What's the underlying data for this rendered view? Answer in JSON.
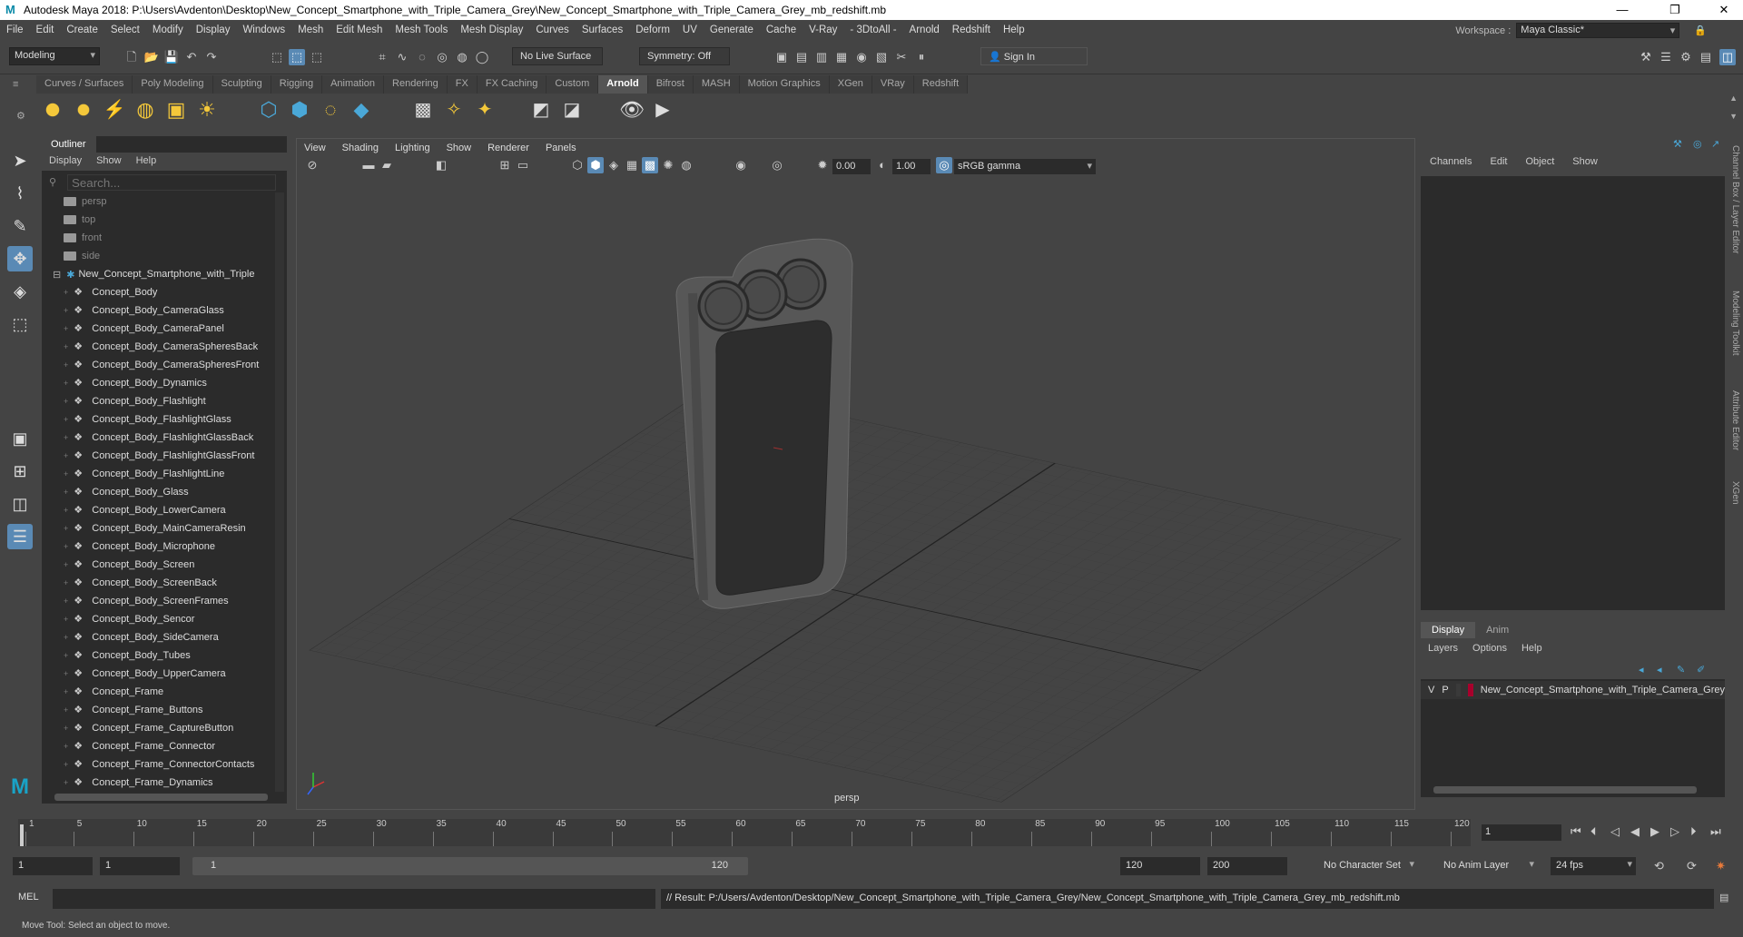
{
  "window": {
    "title": "Autodesk Maya 2018: P:\\Users\\Avdenton\\Desktop\\New_Concept_Smartphone_with_Triple_Camera_Grey\\New_Concept_Smartphone_with_Triple_Camera_Grey_mb_redshift.mb"
  },
  "menubar": [
    "File",
    "Edit",
    "Create",
    "Select",
    "Modify",
    "Display",
    "Windows",
    "Mesh",
    "Edit Mesh",
    "Mesh Tools",
    "Mesh Display",
    "Curves",
    "Surfaces",
    "Deform",
    "UV",
    "Generate",
    "Cache",
    "V-Ray",
    "- 3DtoAll -",
    "Arnold",
    "Redshift",
    "Help"
  ],
  "workspace": {
    "label": "Workspace :",
    "value": "Maya Classic*"
  },
  "statusline": {
    "mode": "Modeling",
    "live_surface": "No Live Surface",
    "symmetry": "Symmetry: Off",
    "sign_in": "Sign In"
  },
  "shelf_tabs": [
    "Curves / Surfaces",
    "Poly Modeling",
    "Sculpting",
    "Rigging",
    "Animation",
    "Rendering",
    "FX",
    "FX Caching",
    "Custom",
    "Arnold",
    "Bifrost",
    "MASH",
    "Motion Graphics",
    "XGen",
    "VRay",
    "Redshift"
  ],
  "shelf_active": "Arnold",
  "outliner": {
    "tab": "Outliner",
    "menu": [
      "Display",
      "Show",
      "Help"
    ],
    "search_placeholder": "Search...",
    "cameras": [
      "persp",
      "top",
      "front",
      "side"
    ],
    "group": "New_Concept_Smartphone_with_Triple",
    "items": [
      "Concept_Body",
      "Concept_Body_CameraGlass",
      "Concept_Body_CameraPanel",
      "Concept_Body_CameraSpheresBack",
      "Concept_Body_CameraSpheresFront",
      "Concept_Body_Dynamics",
      "Concept_Body_Flashlight",
      "Concept_Body_FlashlightGlass",
      "Concept_Body_FlashlightGlassBack",
      "Concept_Body_FlashlightGlassFront",
      "Concept_Body_FlashlightLine",
      "Concept_Body_Glass",
      "Concept_Body_LowerCamera",
      "Concept_Body_MainCameraResin",
      "Concept_Body_Microphone",
      "Concept_Body_Screen",
      "Concept_Body_ScreenBack",
      "Concept_Body_ScreenFrames",
      "Concept_Body_Sencor",
      "Concept_Body_SideCamera",
      "Concept_Body_Tubes",
      "Concept_Body_UpperCamera",
      "Concept_Frame",
      "Concept_Frame_Buttons",
      "Concept_Frame_CaptureButton",
      "Concept_Frame_Connector",
      "Concept_Frame_ConnectorContacts",
      "Concept_Frame_Dynamics"
    ]
  },
  "viewport": {
    "menu": [
      "View",
      "Shading",
      "Lighting",
      "Show",
      "Renderer",
      "Panels"
    ],
    "exposure": "0.00",
    "gamma": "1.00",
    "colorspace": "sRGB gamma",
    "camera_label": "persp"
  },
  "channelbox": {
    "menu": [
      "Channels",
      "Edit",
      "Object",
      "Show"
    ]
  },
  "layers": {
    "tabs": [
      "Display",
      "Anim"
    ],
    "menu": [
      "Layers",
      "Options",
      "Help"
    ],
    "row": {
      "v": "V",
      "p": "P",
      "name": "New_Concept_Smartphone_with_Triple_Camera_Grey",
      "color": "#a8002c"
    }
  },
  "side_tabs": [
    "Channel Box / Layer Editor",
    "Modeling Toolkit",
    "Attribute Editor",
    "XGen"
  ],
  "timeline": {
    "ticks": [
      "1",
      "5",
      "10",
      "15",
      "20",
      "25",
      "30",
      "35",
      "40",
      "45",
      "50",
      "55",
      "60",
      "65",
      "70",
      "75",
      "80",
      "85",
      "90",
      "95",
      "100",
      "105",
      "110",
      "115",
      "120"
    ],
    "current": "1"
  },
  "range": {
    "start": "1",
    "start2": "1",
    "slider_start": "1",
    "slider_end": "120",
    "end": "120",
    "end2": "200",
    "character_set": "No Character Set",
    "anim_layer": "No Anim Layer",
    "fps": "24 fps"
  },
  "commandline": {
    "label": "MEL",
    "result": "// Result: P:/Users/Avdenton/Desktop/New_Concept_Smartphone_with_Triple_Camera_Grey/New_Concept_Smartphone_with_Triple_Camera_Grey_mb_redshift.mb"
  },
  "helpline": "Move Tool: Select an object to move."
}
